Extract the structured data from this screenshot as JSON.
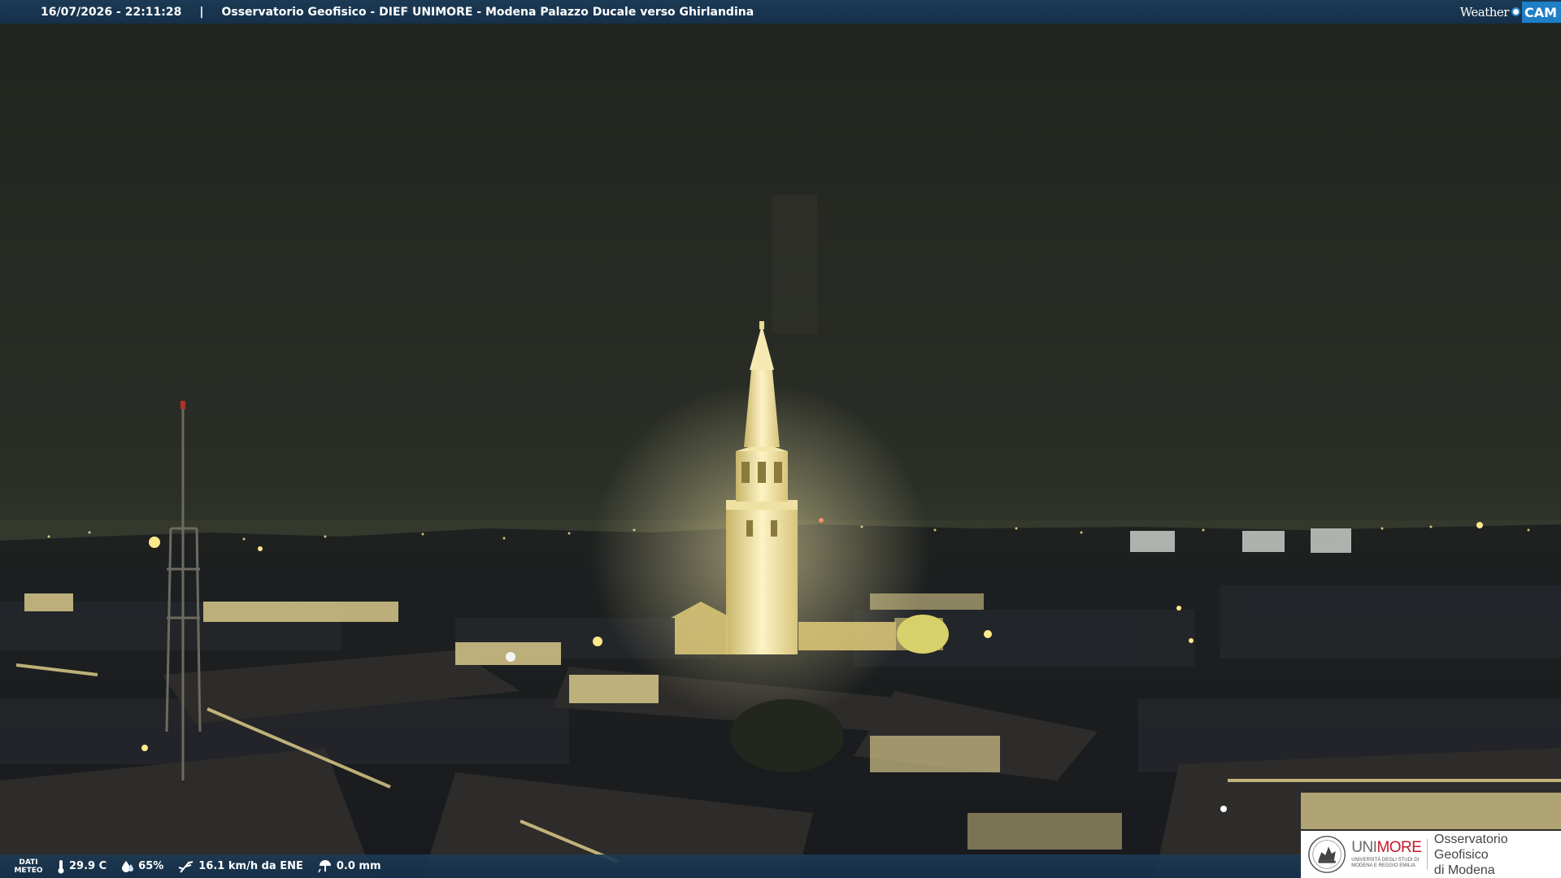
{
  "overlay": {
    "timestamp": "16/07/2026 - 22:11:28",
    "separator": "|",
    "title": "Osservatorio Geofisico - DIEF UNIMORE - Modena Palazzo Ducale verso Ghirlandina"
  },
  "brand": {
    "weather": "Weather",
    "cam": "CAM"
  },
  "weather_bar": {
    "label_line1": "DATI",
    "label_line2": "METEO",
    "temperature": "29.9 C",
    "humidity": "65%",
    "wind": "16.1 km/h da ENE",
    "rain": "0.0 mm",
    "icons": [
      "thermometer-icon",
      "droplet-icon",
      "wind-icon",
      "rain-gauge-icon"
    ]
  },
  "logo": {
    "uni_part1": "UNI",
    "uni_part2": "MORE",
    "uni_subtitle": "UNIVERSITÀ DEGLI STUDI DI MODENA E REGGIO EMILIA",
    "observatory_line1": "Osservatorio Geofisico",
    "observatory_line2": "di Modena",
    "colors": {
      "uni_gray": "#6b6b6b",
      "more_red": "#c9182b"
    }
  },
  "scene": {
    "description_colors": {
      "sky": "#2a2f27",
      "glow": "#f6e7a0",
      "lights": "#ffe98a"
    }
  }
}
